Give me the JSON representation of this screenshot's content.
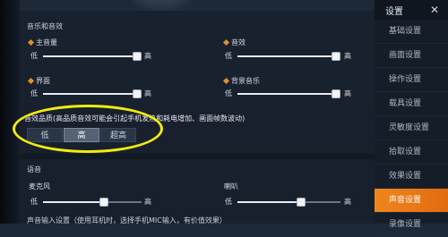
{
  "sidebar": {
    "header": "设置",
    "close": "✕",
    "items": [
      {
        "label": "基础设置"
      },
      {
        "label": "画面设置"
      },
      {
        "label": "操作设置"
      },
      {
        "label": "载具设置"
      },
      {
        "label": "灵敏度设置"
      },
      {
        "label": "拾取设置"
      },
      {
        "label": "效果设置"
      },
      {
        "label": "声音设置",
        "active": true
      },
      {
        "label": "录像设置"
      }
    ]
  },
  "music": {
    "title": "音乐和音效",
    "low": "低",
    "high": "高",
    "sliders": [
      {
        "label": "主音量",
        "value": 1.0
      },
      {
        "label": "音效",
        "value": 1.0
      },
      {
        "label": "界面",
        "value": 1.0
      },
      {
        "label": "背景音乐",
        "value": 1.0
      }
    ]
  },
  "quality": {
    "label": "音效品质(高品质音效可能会引起手机发热和耗电增加、画面帧数波动)",
    "options": [
      "低",
      "高",
      "超高"
    ],
    "selected": "高"
  },
  "voice": {
    "title": "语音",
    "mic_label": "麦克风",
    "speaker_label": "喇叭",
    "low": "低",
    "high": "高",
    "mic_value": 0.62,
    "speaker_value": 0.62,
    "bottom_text": "声音输入设置（使用耳机时，选择手机MIC输入，有价值效果）"
  },
  "colors": {
    "accent": "#f0861c",
    "highlight": "#f3ea10"
  }
}
